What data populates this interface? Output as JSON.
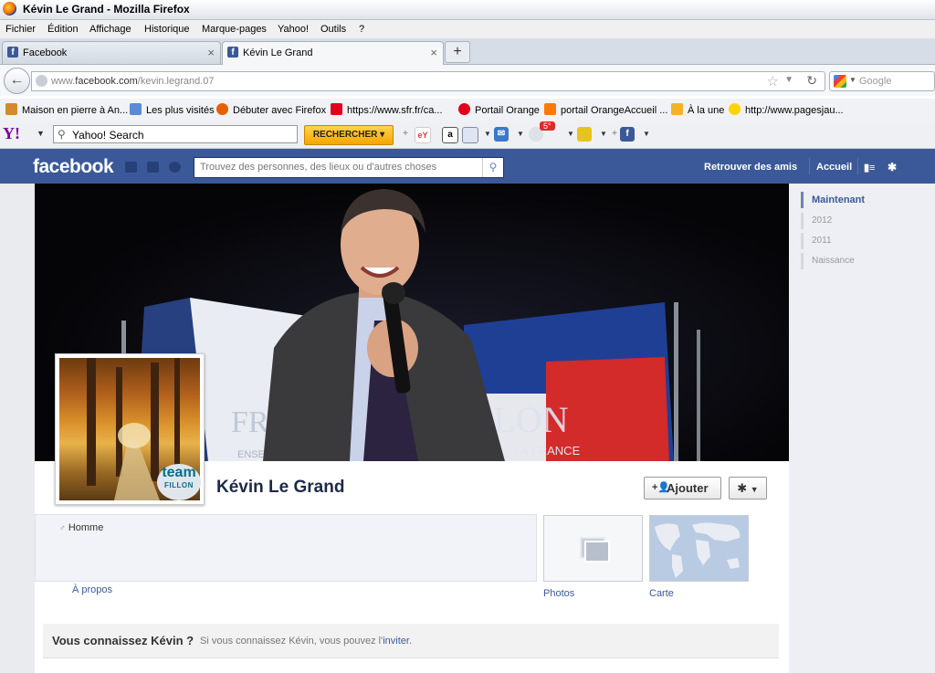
{
  "window": {
    "title": "Kévin Le Grand - Mozilla Firefox"
  },
  "menu": [
    "Fichier",
    "Édition",
    "Affichage",
    "Historique",
    "Marque-pages",
    "Yahoo!",
    "Outils",
    "?"
  ],
  "tabs": [
    {
      "label": "Facebook"
    },
    {
      "label": "Kévin Le Grand"
    }
  ],
  "nav": {
    "url_prefix": "www.",
    "url_domain": "facebook.com",
    "url_path": "/kevin.legrand.07",
    "search_placeholder": "Google"
  },
  "bookmarks": [
    {
      "label": "Maison en pierre à An...",
      "color": "#d48a2a"
    },
    {
      "label": "Les plus visités",
      "color": "#5b8ad6"
    },
    {
      "label": "Débuter avec Firefox",
      "color": "#e66000"
    },
    {
      "label": "https://www.sfr.fr/ca...",
      "color": "#e2001a"
    },
    {
      "label": "Portail Orange",
      "color": "#e2001a"
    },
    {
      "label": "portail OrangeAccueil ...",
      "color": "#ff7900"
    },
    {
      "label": "À la une",
      "color": "#f5b324"
    },
    {
      "label": "http://www.pagesjau...",
      "color": "#ffd400"
    }
  ],
  "yahoo": {
    "logo": "Y!",
    "search_value": "Yahoo! Search",
    "button_label": "RECHERCHER",
    "weather": "5°"
  },
  "facebook": {
    "logo": "facebook",
    "search_placeholder": "Trouvez des personnes, des lieux ou d'autres choses",
    "nav_find_friends": "Retrouver des amis",
    "nav_home": "Accueil",
    "profile_name": "Kévin Le Grand",
    "add_button": "Ajouter",
    "gender": "Homme",
    "about_link": "À propos",
    "photos_label": "Photos",
    "map_label": "Carte",
    "badge_top": "team",
    "badge_bottom": "FILLON",
    "cover_text_left": "FR",
    "cover_text_right": "LLON",
    "cover_subtext_left": "ENSE",
    "cover_subtext_right": "LA FRANCE",
    "know_title": "Vous connaissez Kévin ?",
    "know_desc": "Si vous connaissez Kévin, vous pouvez l'",
    "know_link": "inviter",
    "know_end": "."
  },
  "timeline": [
    "Maintenant",
    "2012",
    "2011",
    "Naissance"
  ],
  "colors": {
    "fb_blue": "#3b5998",
    "link": "#3b5998"
  }
}
